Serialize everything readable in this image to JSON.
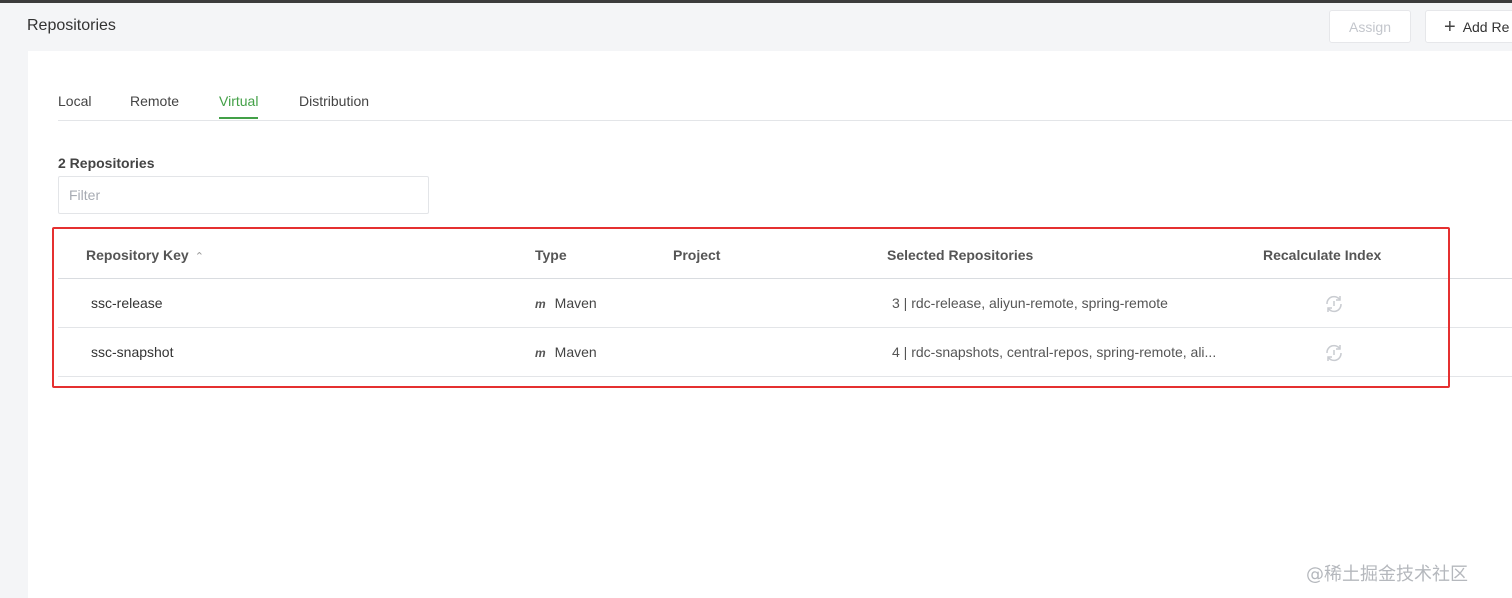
{
  "header": {
    "title": "Repositories",
    "assign_label": "Assign",
    "add_label": "Add Re"
  },
  "tabs": [
    {
      "label": "Local",
      "active": false
    },
    {
      "label": "Remote",
      "active": false
    },
    {
      "label": "Virtual",
      "active": true
    },
    {
      "label": "Distribution",
      "active": false
    }
  ],
  "list": {
    "count_label": "2 Repositories",
    "filter_placeholder": "Filter"
  },
  "table": {
    "columns": {
      "key": "Repository Key",
      "type": "Type",
      "project": "Project",
      "selected": "Selected Repositories",
      "recalc": "Recalculate Index"
    },
    "rows": [
      {
        "key": "ssc-release",
        "type_icon": "m",
        "type": "Maven",
        "project": "",
        "selected": "3 | rdc-release, aliyun-remote, spring-remote"
      },
      {
        "key": "ssc-snapshot",
        "type_icon": "m",
        "type": "Maven",
        "project": "",
        "selected": "4 | rdc-snapshots, central-repos, spring-remote, ali..."
      }
    ]
  },
  "colors": {
    "accent": "#43a047",
    "highlight": "#e53030"
  },
  "watermark": "@稀土掘金技术社区"
}
